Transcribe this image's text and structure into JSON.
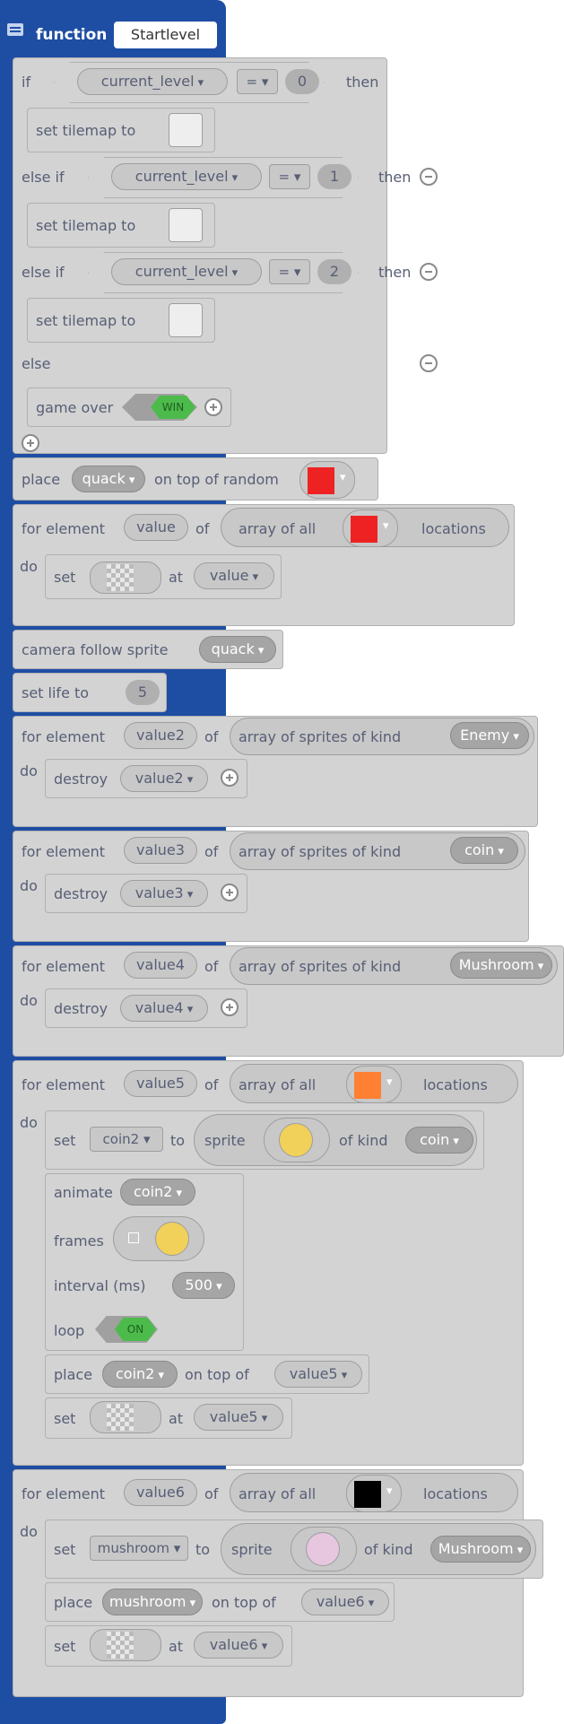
{
  "function": {
    "keyword": "function",
    "name": "Startlevel"
  },
  "if_block": {
    "if": "if",
    "then": "then",
    "else_if": "else if",
    "else": "else",
    "var": "current_level",
    "op": "=",
    "values": [
      "0",
      "1",
      "2"
    ],
    "set_tilemap": "set tilemap to",
    "game_over": "game over",
    "win": "WIN"
  },
  "place": {
    "label": "place",
    "sprite": "quack",
    "on_top": "on top of random"
  },
  "loops": {
    "for_element": "for element",
    "of": "of",
    "do": "do",
    "array_of_all": "array of all",
    "locations": "locations",
    "array_sprites_kind": "array of sprites of kind",
    "set": "set",
    "at": "at",
    "destroy": "destroy",
    "vars": [
      "value",
      "value2",
      "value3",
      "value4",
      "value5",
      "value6"
    ],
    "kinds": [
      "Enemy",
      "coin",
      "Mushroom"
    ]
  },
  "camera": {
    "label": "camera follow sprite",
    "sprite": "quack"
  },
  "life": {
    "label": "set life to",
    "value": "5"
  },
  "coin_section": {
    "set_label": "set",
    "var": "coin2",
    "to": "to",
    "sprite": "sprite",
    "of_kind": "of kind",
    "kind": "coin",
    "animate": "animate",
    "frames": "frames",
    "interval": "interval (ms)",
    "interval_value": "500",
    "loop": "loop",
    "on": "ON",
    "place": "place",
    "on_top_of": "on top of"
  },
  "mushroom_section": {
    "var": "mushroom",
    "kind": "Mushroom"
  },
  "colors": {
    "red": "#ee2222",
    "orange": "#ff8033",
    "black": "#000000",
    "blue": "#1e4ea4"
  }
}
